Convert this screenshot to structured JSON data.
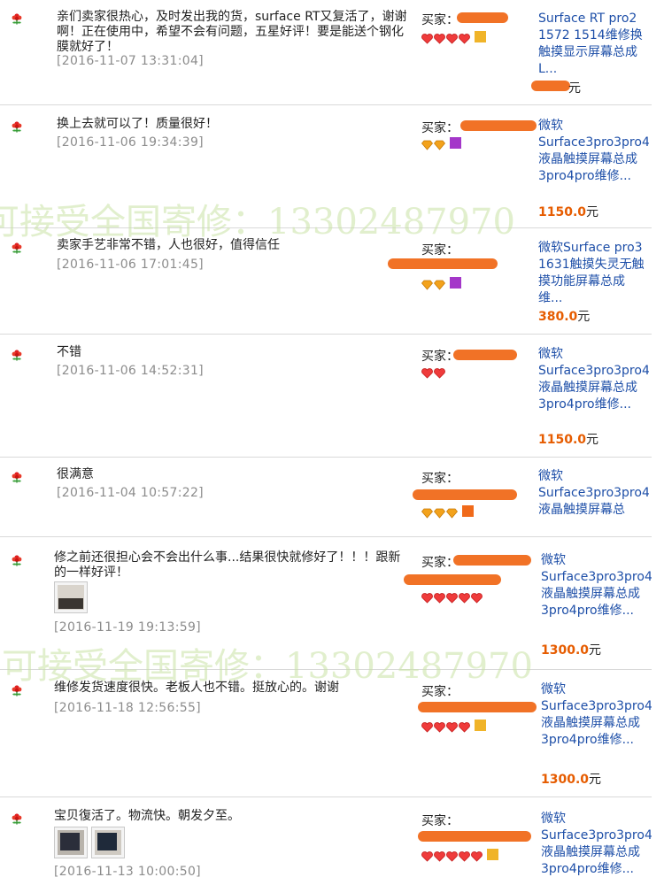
{
  "watermark": "可接受全国寄修：13302487970",
  "buyer_label": "买家：",
  "price_unit": "元",
  "reviews": [
    {
      "comment": "亲们卖家很热心，及时发出我的货，surface RT又复活了，谢谢啊！正在使用中，希望不会有问题，五星好评！要是能送个钢化膜就好了！",
      "date": "[2016-11-07 13:31:04]",
      "product": "Surface RT pro2 1572 1514维修换触摸显示屏幕总成L...",
      "price": "",
      "hearts": 4,
      "vip": "gold"
    },
    {
      "comment": "换上去就可以了！质量很好！",
      "date": "[2016-11-06 19:34:39]",
      "product": "微软Surface3pro3pro4液晶触摸屏幕总成3pro4pro维修...",
      "price": "1150.0",
      "hearts": 2,
      "vip": "purple"
    },
    {
      "comment": "卖家手艺非常不错，人也很好，值得信任",
      "date": "[2016-11-06 17:01:45]",
      "product": "微软Surface pro3 1631触摸失灵无触摸功能屏幕总成维...",
      "price": "380.0",
      "hearts": 2,
      "vip": "purple"
    },
    {
      "comment": "不错",
      "date": "[2016-11-06 14:52:31]",
      "product": "微软Surface3pro3pro4液晶触摸屏幕总成3pro4pro维修...",
      "price": "1150.0",
      "hearts": 2,
      "vip": ""
    },
    {
      "comment": "很满意",
      "date": "[2016-11-04 10:57:22]",
      "product": "微软Surface3pro3pro4液晶触摸屏幕总",
      "price": "",
      "hearts": 3,
      "vip": "orange"
    },
    {
      "comment": "修之前还很担心会不会出什么事...结果很快就修好了！！！跟新的一样好评！",
      "date": "[2016-11-19 19:13:59]",
      "product": "微软Surface3pro3pro4液晶触摸屏幕总成3pro4pro维修...",
      "price": "1300.0",
      "hearts": 5,
      "vip": ""
    },
    {
      "comment": "维修发货速度很快。老板人也不错。挺放心的。谢谢",
      "date": "[2016-11-18 12:56:55]",
      "product": "微软Surface3pro3pro4液晶触摸屏幕总成3pro4pro维修...",
      "price": "1300.0",
      "hearts": 4,
      "vip": "gold"
    },
    {
      "comment": "宝贝復活了。物流快。朝发夕至。",
      "date": "[2016-11-13 10:00:50]",
      "product": "微软Surface3pro3pro4液晶触摸屏幕总成3pro4pro维修...",
      "price": "",
      "hearts": 5,
      "vip": "gold"
    }
  ]
}
